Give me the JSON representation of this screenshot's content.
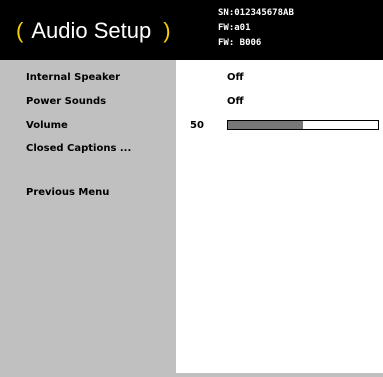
{
  "header": {
    "title": "Audio Setup",
    "open_paren": "(",
    "close_paren": ")",
    "serial": "SN:012345678AB",
    "fw_a": "FW:a01",
    "fw_b": "FW: B006"
  },
  "menu": {
    "items": [
      {
        "label": "Internal Speaker",
        "value": "Off"
      },
      {
        "label": "Power Sounds",
        "value": "Off"
      },
      {
        "label": "Volume",
        "value": "50"
      },
      {
        "label": "Closed Captions ..."
      },
      {
        "label": "Previous Menu"
      }
    ]
  },
  "volume": {
    "level": 0.5
  },
  "colors": {
    "header_bg": "#000000",
    "accent_paren": "#f2d200",
    "sidebar_bg": "#c0c0c0",
    "slider_fill": "#777777"
  }
}
